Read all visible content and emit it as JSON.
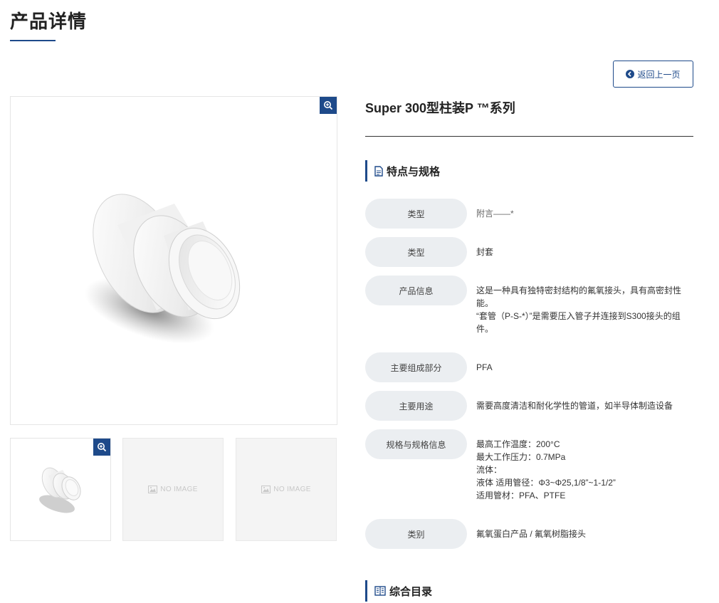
{
  "page": {
    "title": "产品详情",
    "back_label": "返回上一页"
  },
  "product": {
    "name": "Super 300型柱装P ™系列"
  },
  "gallery": {
    "no_image_label": "NO IMAGE"
  },
  "sections": {
    "features_title": "特点与规格",
    "catalog_title": "综合目录"
  },
  "specs": [
    {
      "label": "类型",
      "lines": [
        "附言——*"
      ]
    },
    {
      "label": "类型",
      "lines": [
        "封套"
      ]
    },
    {
      "label": "产品信息",
      "lines": [
        "这是一种具有独特密封结构的氟氧接头，具有高密封性",
        "能。",
        "“套管（P-S-*）”是需要压入管子并连接到S300接头的组",
        "件。"
      ]
    },
    {
      "label": "主要组成部分",
      "lines": [
        "PFA"
      ]
    },
    {
      "label": "主要用途",
      "lines": [
        "需要高度清洁和耐化学性的管道，如半导体制造设备"
      ]
    },
    {
      "label": "规格与规格信息",
      "lines": [
        "最高工作温度：200°C",
        "最大工作压力：0.7MPa",
        "流体：",
        "液体 适用管径：Φ3~Φ25,1/8”~1-1/2”",
        "适用管材：PFA、PTFE"
      ]
    },
    {
      "label": "类别",
      "lines": [
        "氟氧蛋白产品 / 氟氧树脂接头"
      ]
    }
  ],
  "colors": {
    "accent": "#1e4a8a",
    "label_bg": "#ebeef1"
  }
}
